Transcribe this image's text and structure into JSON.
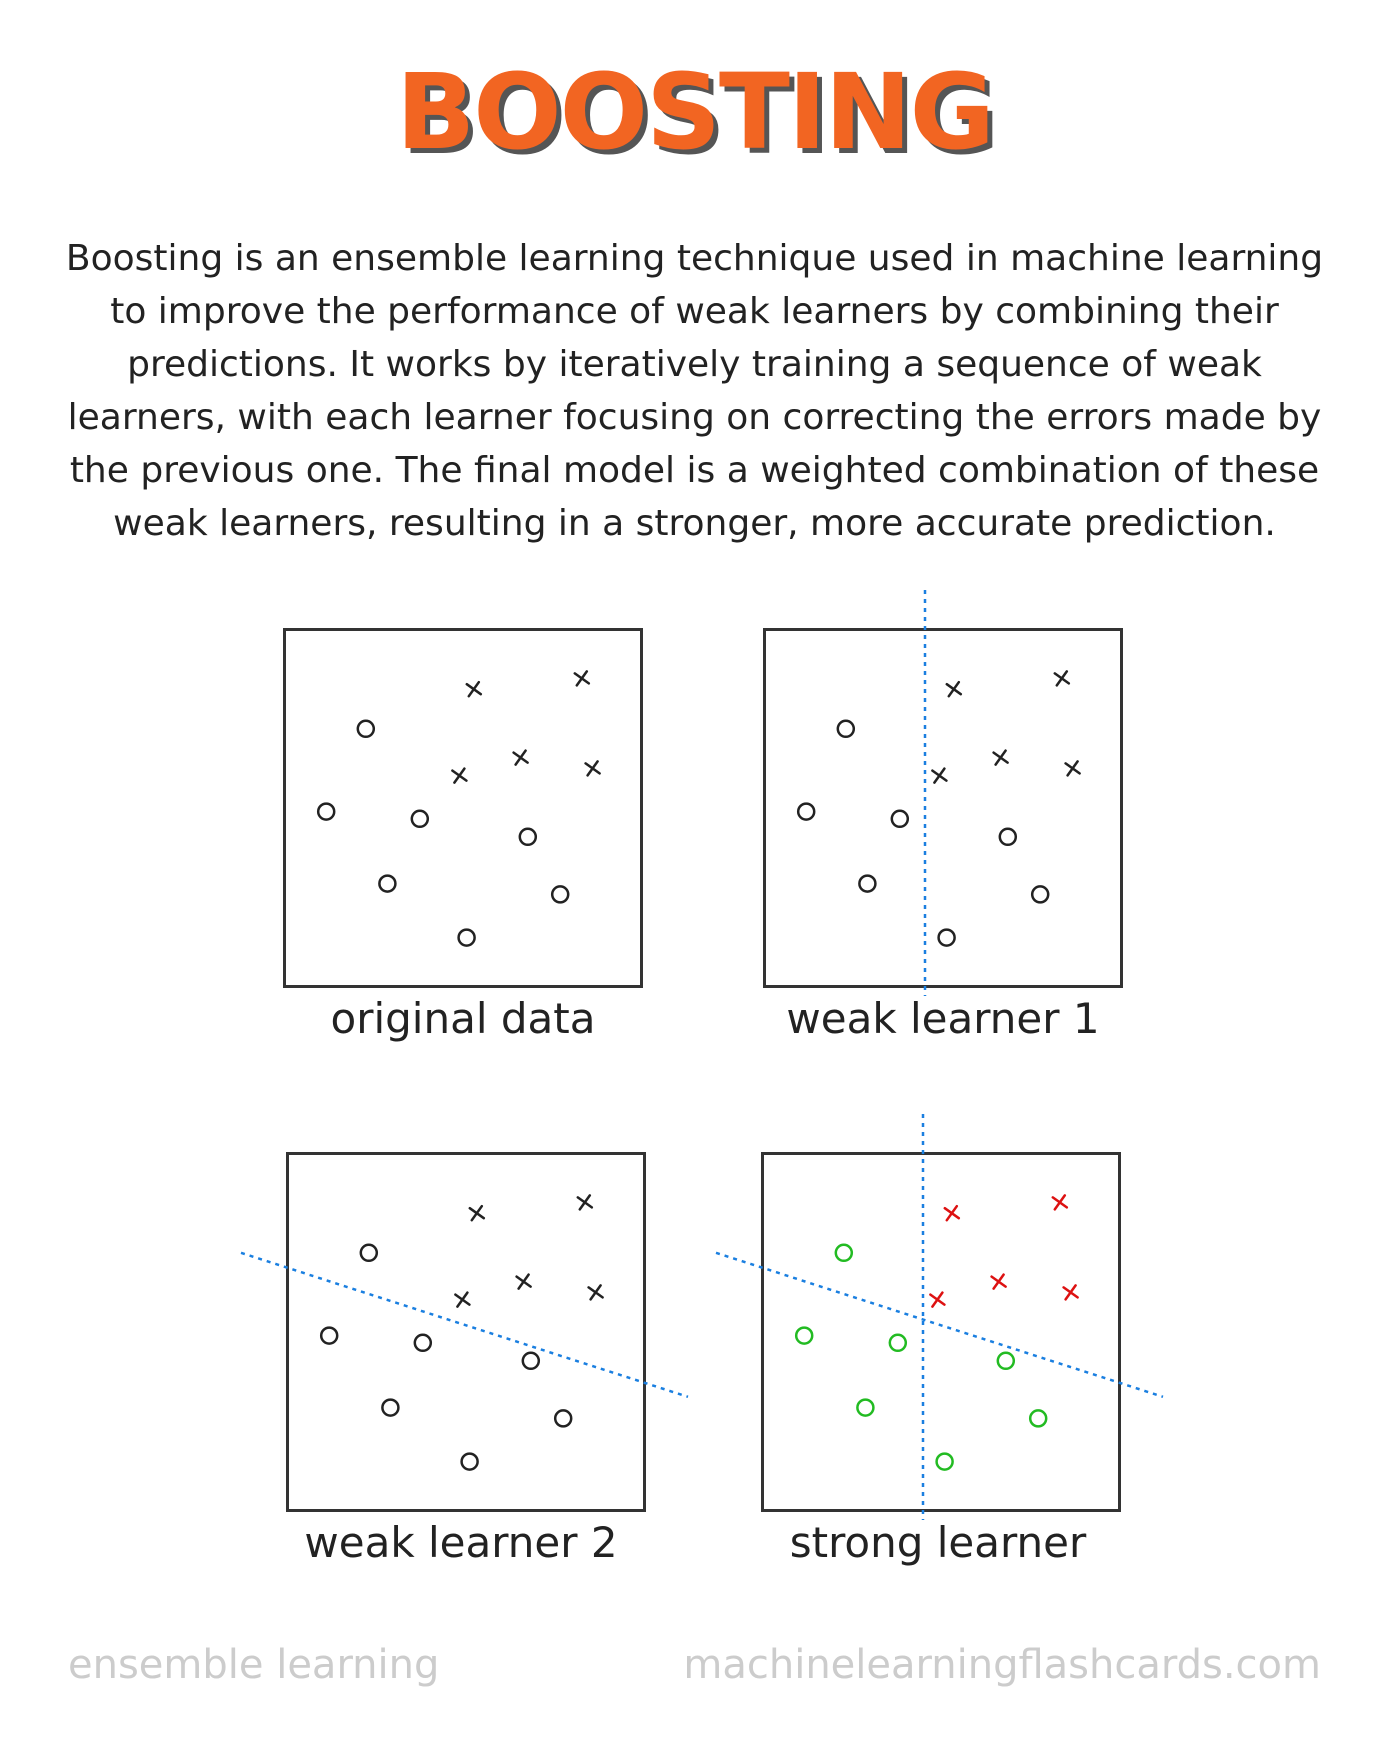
{
  "title": "BOOSTING",
  "description": "Boosting is an ensemble learning technique used in machine learning to improve the performance of weak learners by combining their predictions. It works by iteratively training a sequence of weak learners, with each learner focusing on correcting the errors made by the previous one. The final model is a weighted combination of these weak learners, resulting in a stronger, more accurate prediction.",
  "colors": {
    "title": "#f26522",
    "title_shadow": "#555555",
    "divider": "#1a7fe0",
    "positive": "#dd1111",
    "negative": "#22bb22",
    "neutral": "#222222",
    "footer": "#cccccc"
  },
  "panels": [
    {
      "caption": "original data",
      "vertical_split": false,
      "diagonal_split": false,
      "colored": false
    },
    {
      "caption": "weak learner 1",
      "vertical_split": true,
      "diagonal_split": false,
      "colored": false
    },
    {
      "caption": "weak learner 2",
      "vertical_split": false,
      "diagonal_split": true,
      "colored": false
    },
    {
      "caption": "strong learner",
      "vertical_split": true,
      "diagonal_split": true,
      "colored": true
    }
  ],
  "points": {
    "circles": [
      [
        0.23,
        0.28
      ],
      [
        0.12,
        0.51
      ],
      [
        0.38,
        0.53
      ],
      [
        0.29,
        0.71
      ],
      [
        0.68,
        0.58
      ],
      [
        0.77,
        0.74
      ],
      [
        0.51,
        0.86
      ]
    ],
    "crosses": [
      [
        0.53,
        0.17
      ],
      [
        0.83,
        0.14
      ],
      [
        0.49,
        0.41
      ],
      [
        0.66,
        0.36
      ],
      [
        0.86,
        0.39
      ]
    ]
  },
  "footer": {
    "left": "ensemble learning",
    "right": "machinelearningflashcards.com"
  }
}
